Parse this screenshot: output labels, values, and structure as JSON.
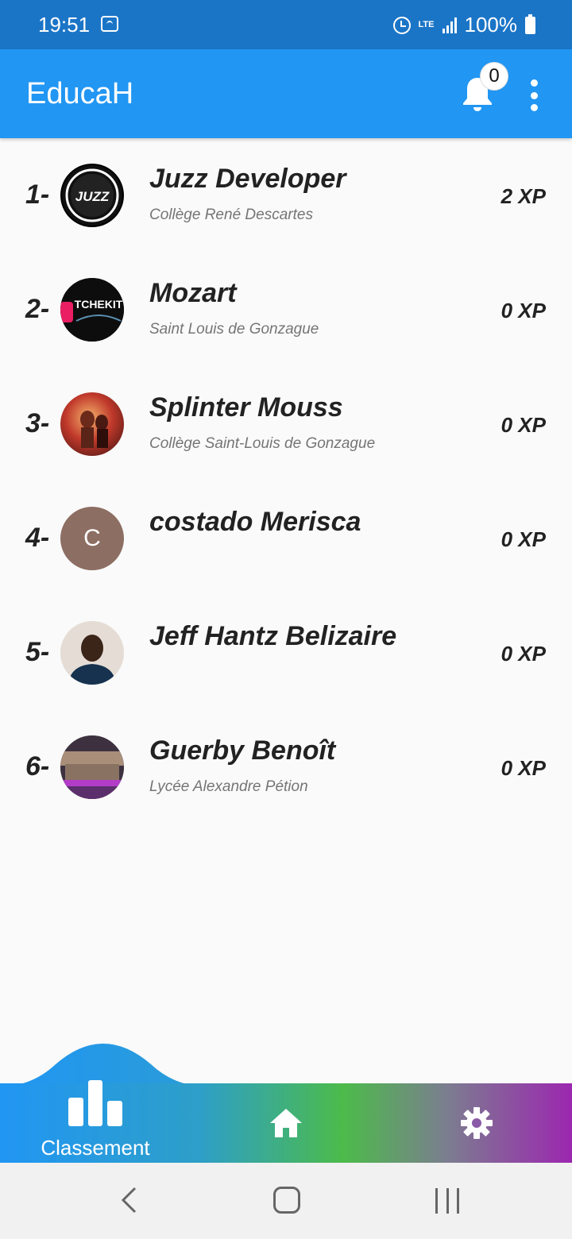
{
  "status_bar": {
    "time": "19:51",
    "network": "LTE",
    "battery": "100%"
  },
  "app_bar": {
    "title": "EducaH",
    "notification_count": "0"
  },
  "ranking": [
    {
      "rank": "1-",
      "name": "Juzz Developer",
      "school": "Collège René Descartes",
      "xp": "2 XP",
      "avatar_text": "JUZZ"
    },
    {
      "rank": "2-",
      "name": "Mozart",
      "school": "Saint Louis de Gonzague",
      "xp": "0 XP",
      "avatar_text": "TCHEKIT"
    },
    {
      "rank": "3-",
      "name": "Splinter Mouss",
      "school": "Collège Saint-Louis de Gonzague",
      "xp": "0 XP"
    },
    {
      "rank": "4-",
      "name": "costado Merisca",
      "school": "",
      "xp": "0 XP",
      "avatar_letter": "C"
    },
    {
      "rank": "5-",
      "name": "Jeff Hantz Belizaire",
      "school": "",
      "xp": "0 XP"
    },
    {
      "rank": "6-",
      "name": "Guerby Benoît",
      "school": "Lycée Alexandre Pétion",
      "xp": "0 XP"
    }
  ],
  "bottom_nav": {
    "classement_label": "Classement",
    "items": [
      "ranking-icon",
      "home-icon",
      "settings-icon"
    ]
  },
  "colors": {
    "status_bar": "#1b75c7",
    "app_bar": "#2196f3",
    "nav_gradient_start": "#2196f3",
    "nav_gradient_mid": "#4cbb4a",
    "nav_gradient_end": "#9c27b0"
  }
}
